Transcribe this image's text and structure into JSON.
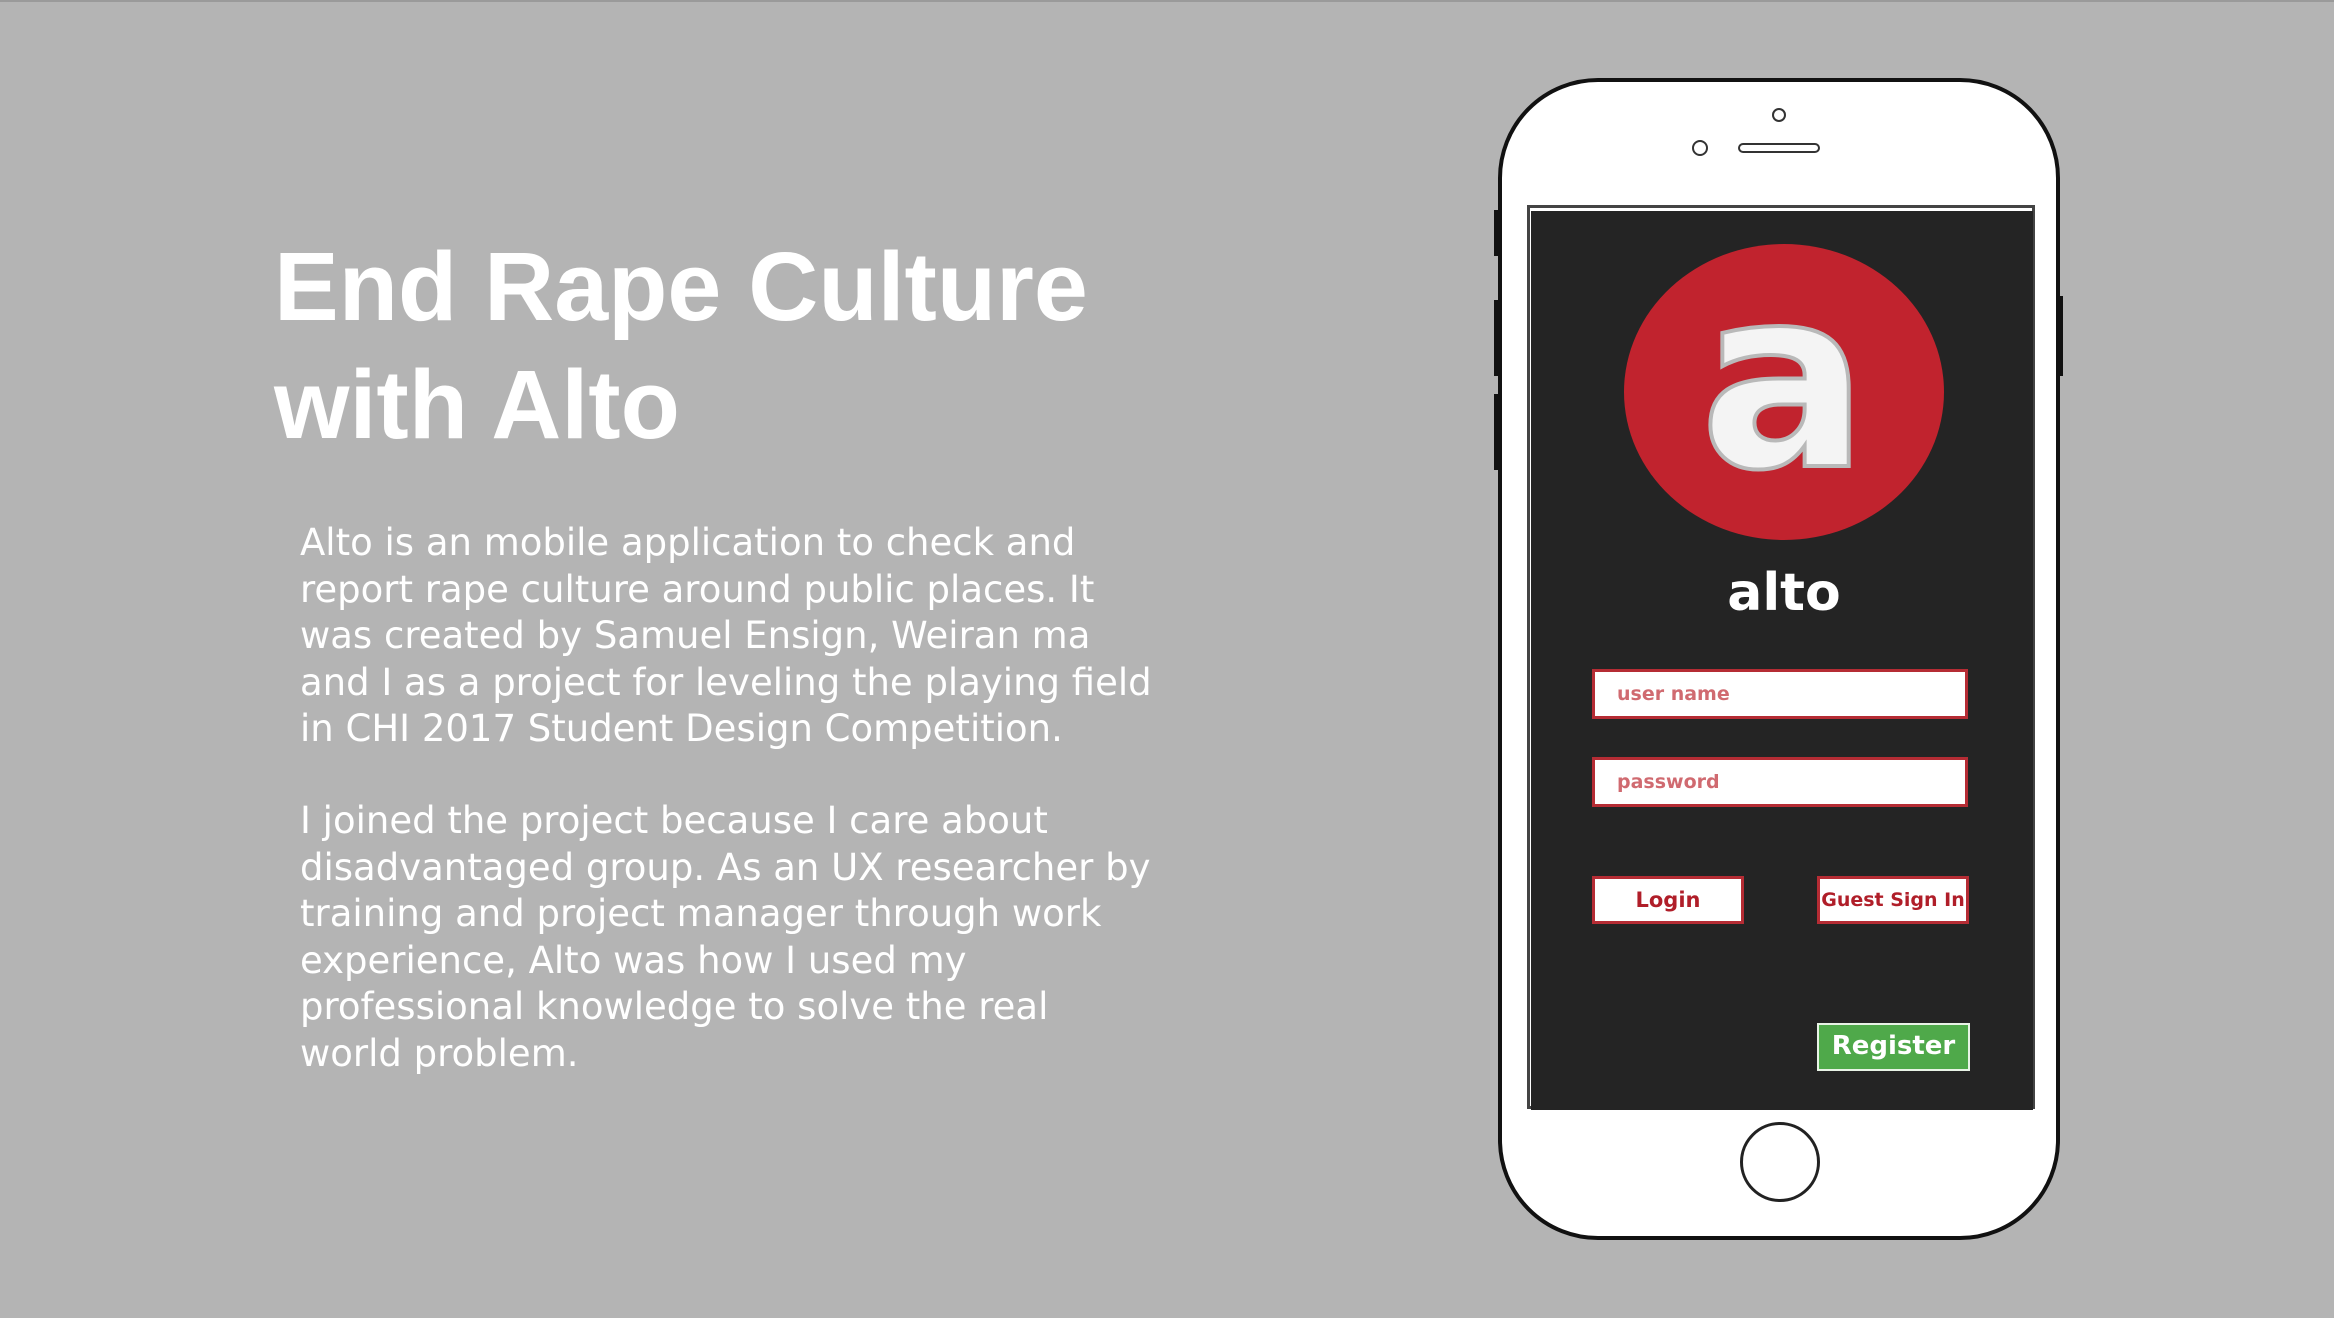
{
  "heading": {
    "line1": "End Rape Culture",
    "line2": "with Alto"
  },
  "description": {
    "paragraph1": [
      "Alto is an mobile application to check and",
      "report rape culture around public places. It",
      "was created by Samuel Ensign, Weiran ma",
      "and I as a project for leveling the playing field",
      "in CHI 2017 Student Design Competition."
    ],
    "paragraph2": [
      "I joined the project because I care about",
      "disadvantaged group. As an UX researcher by",
      "training and project manager through work",
      "experience, Alto was how I used my",
      "professional knowledge to solve the real",
      "world problem."
    ]
  },
  "app": {
    "logo_letter": "a",
    "wordmark": "alto",
    "username_placeholder": "user name",
    "password_placeholder": "password",
    "login_label": "Login",
    "guest_label": "Guest Sign In",
    "register_label": "Register",
    "colors": {
      "brand_red": "#c1232e",
      "screen_background": "#242424",
      "register_green": "#4fa94a",
      "page_background": "#b4b4b4"
    }
  },
  "icons": {
    "logo": "alto-logo-icon",
    "home_button": "home-button-icon",
    "camera": "camera-icon",
    "speaker": "speaker-icon"
  }
}
